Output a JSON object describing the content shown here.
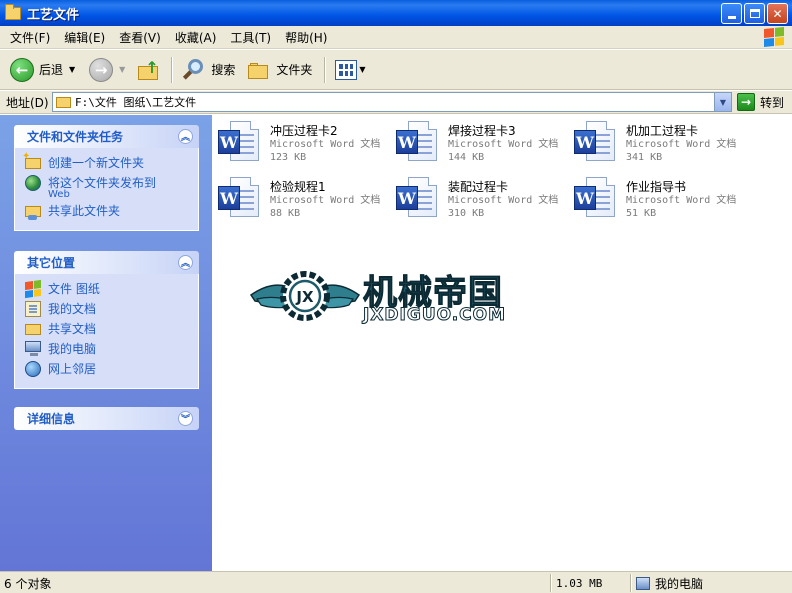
{
  "window": {
    "title": "工艺文件"
  },
  "menu": {
    "items": [
      "文件(F)",
      "编辑(E)",
      "查看(V)",
      "收藏(A)",
      "工具(T)",
      "帮助(H)"
    ]
  },
  "toolbar": {
    "back_label": "后退",
    "search_label": "搜索",
    "folders_label": "文件夹"
  },
  "address": {
    "label": "地址(D)",
    "path": "F:\\文件  图纸\\工艺文件",
    "go_label": "转到"
  },
  "tasks": {
    "file_tasks": {
      "title": "文件和文件夹任务",
      "items": [
        {
          "label": "创建一个新文件夹",
          "icon": "new-folder-icon"
        },
        {
          "label": "将这个文件夹发布到",
          "sub": "Web",
          "icon": "globe-icon"
        },
        {
          "label": "共享此文件夹",
          "icon": "share-folder-icon"
        }
      ]
    },
    "other_places": {
      "title": "其它位置",
      "items": [
        {
          "label": "文件  图纸",
          "icon": "windows-logo-icon"
        },
        {
          "label": "我的文档",
          "icon": "my-documents-icon"
        },
        {
          "label": "共享文档",
          "icon": "shared-documents-icon"
        },
        {
          "label": "我的电脑",
          "icon": "my-computer-icon"
        },
        {
          "label": "网上邻居",
          "icon": "network-places-icon"
        }
      ]
    },
    "details": {
      "title": "详细信息"
    }
  },
  "files": [
    {
      "name": "冲压过程卡2",
      "type": "Microsoft Word 文档",
      "size": "123 KB"
    },
    {
      "name": "焊接过程卡3",
      "type": "Microsoft Word 文档",
      "size": "144 KB"
    },
    {
      "name": "机加工过程卡",
      "type": "Microsoft Word 文档",
      "size": "341 KB"
    },
    {
      "name": "检验规程1",
      "type": "Microsoft Word 文档",
      "size": "88 KB"
    },
    {
      "name": "装配过程卡",
      "type": "Microsoft Word 文档",
      "size": "310 KB"
    },
    {
      "name": "作业指导书",
      "type": "Microsoft Word 文档",
      "size": "51 KB"
    }
  ],
  "watermark": {
    "cn": "机械帝国",
    "en": "JXDIGUO.COM",
    "badge": "JX"
  },
  "status": {
    "objects": "6 个对象",
    "size": "1.03 MB",
    "location": "我的电脑"
  },
  "colors": {
    "title_blue": "#0055e5",
    "task_pane": "#6f8ce0",
    "link_blue": "#215dc6"
  }
}
